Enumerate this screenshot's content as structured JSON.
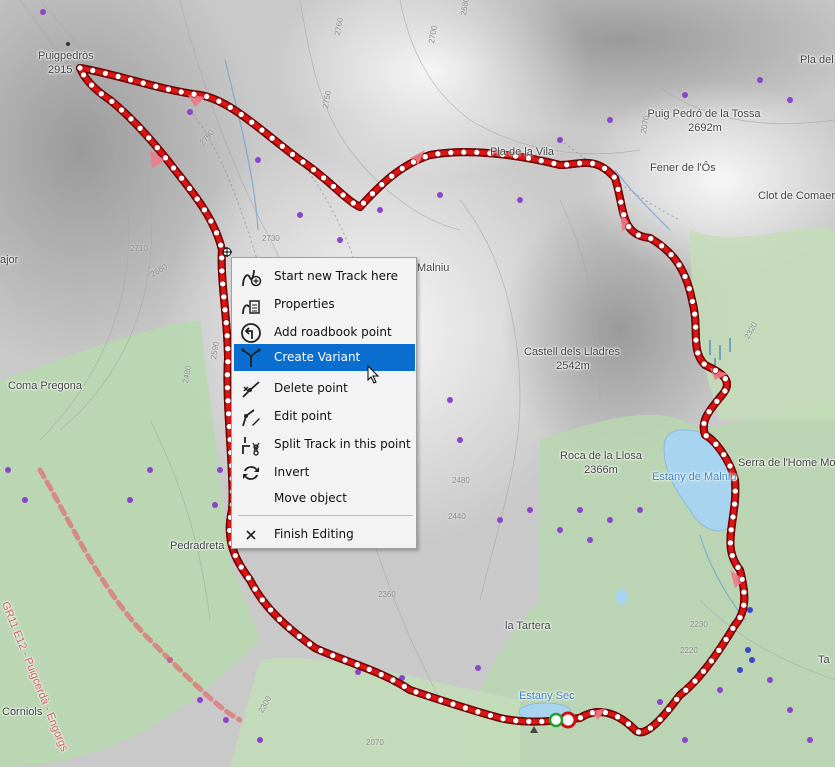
{
  "map": {
    "peaks": [
      {
        "name": "Puigpedròs",
        "elev": "2915"
      },
      {
        "name": "Puig Pedró de la Tossa",
        "elev": "2692m"
      },
      {
        "name": "Castell dels Lladres",
        "elev": "2542m"
      },
      {
        "name": "Roca de la Llosa",
        "elev": "2366m"
      }
    ],
    "places": {
      "pla_vila": "Pla de la Vila",
      "pla_del": "Pla del",
      "fener": "Fener de l'Ôs",
      "clot": "Clot de Comaer",
      "malniu": "Malniu",
      "coma_pregona": "Coma Pregona",
      "major": "ajor",
      "pedradreta": "Pedradreta",
      "tartera": "la Tartera",
      "serra": "Serra de l'Home Mort",
      "corniols": "Corniols",
      "ta": "Ta"
    },
    "lakes": {
      "malniu": "Estany de Malniu",
      "sec": "Estany Sec"
    },
    "trail": "GR11 E12 - Puigcerdà - Engorgs",
    "contours": [
      "2680",
      "2700",
      "2750",
      "2760",
      "2790",
      "2730",
      "2710",
      "2660",
      "2590",
      "2480",
      "2480",
      "2440",
      "2360",
      "2320",
      "2220",
      "2300",
      "2070",
      "2070",
      "2230"
    ]
  },
  "context_menu": {
    "items": [
      {
        "label": "Start new Track here",
        "icon": "track-start-icon"
      },
      {
        "label": "Properties",
        "icon": "properties-icon"
      },
      {
        "label": "Add roadbook point",
        "icon": "roadbook-icon"
      },
      {
        "label": "Create Variant",
        "icon": "variant-icon"
      },
      {
        "label": "Delete point",
        "icon": "delete-point-icon"
      },
      {
        "label": "Edit point",
        "icon": "edit-point-icon"
      },
      {
        "label": "Split Track in this point",
        "icon": "split-icon"
      },
      {
        "label": "Invert",
        "icon": "invert-icon"
      },
      {
        "label": "Move object",
        "icon": ""
      },
      {
        "label": "Finish Editing",
        "icon": "close-icon"
      }
    ],
    "selected": "Create Variant"
  },
  "colors": {
    "track": "#cc1111",
    "highlight": "#0a6ed0",
    "lake": "#a8d4f0",
    "trail": "#e07070",
    "poi": "#8a44c8"
  }
}
